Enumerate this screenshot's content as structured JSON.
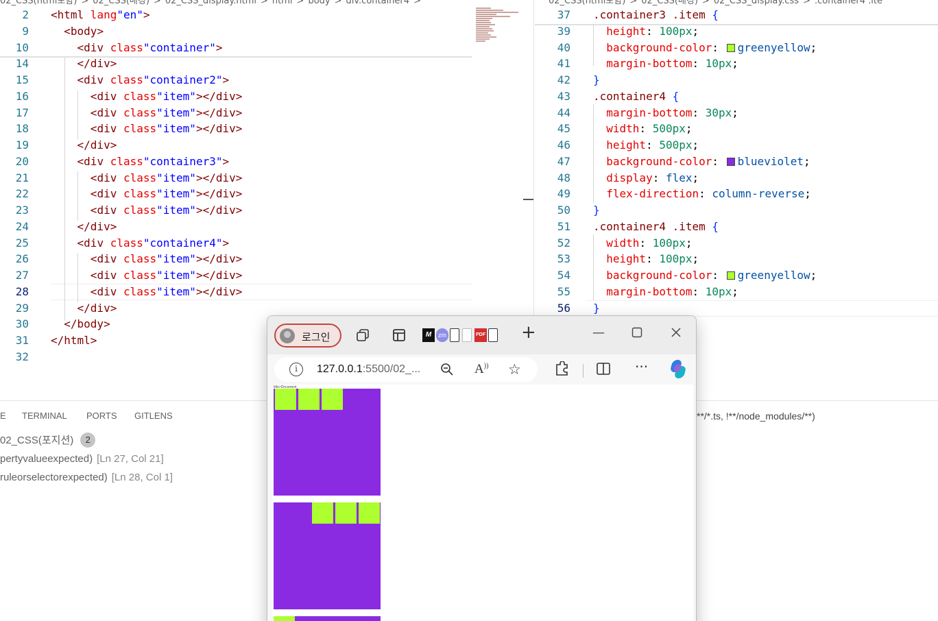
{
  "editor_left": {
    "breadcrumb": [
      "02_CSS(html포함)",
      ">",
      "02_CSS(배경)",
      ">",
      "02_CSS_display.html",
      ">",
      "html",
      ">",
      "body",
      ">",
      "div.container4",
      ">"
    ],
    "lines": [
      {
        "n": "2",
        "code": "<html lang=\"en\">"
      },
      {
        "n": "9",
        "code": "  <body>"
      },
      {
        "n": "10",
        "code": "    <div class=\"container\">"
      },
      {
        "n": "14",
        "code": "    </div>"
      },
      {
        "n": "15",
        "code": "    <div class=\"container2\">"
      },
      {
        "n": "16",
        "code": "      <div class=\"item\"></div>"
      },
      {
        "n": "17",
        "code": "      <div class=\"item\"></div>"
      },
      {
        "n": "18",
        "code": "      <div class=\"item\"></div>"
      },
      {
        "n": "19",
        "code": "    </div>"
      },
      {
        "n": "20",
        "code": "    <div class=\"container3\">"
      },
      {
        "n": "21",
        "code": "      <div class=\"item\"></div>"
      },
      {
        "n": "22",
        "code": "      <div class=\"item\"></div>"
      },
      {
        "n": "23",
        "code": "      <div class=\"item\"></div>"
      },
      {
        "n": "24",
        "code": "    </div>"
      },
      {
        "n": "25",
        "code": "    <div class=\"container4\">"
      },
      {
        "n": "26",
        "code": "      <div class=\"item\"></div>"
      },
      {
        "n": "27",
        "code": "      <div class=\"item\"></div>"
      },
      {
        "n": "28",
        "code": "      <div class=\"item\"></div>"
      },
      {
        "n": "29",
        "code": "    </div>"
      },
      {
        "n": "30",
        "code": "  </body>"
      },
      {
        "n": "31",
        "code": "</html>"
      },
      {
        "n": "32",
        "code": ""
      }
    ]
  },
  "editor_right": {
    "breadcrumb": [
      "02_CSS(html포함)",
      ">",
      "02_CSS(배경)",
      ">",
      "02_CSS_display.css",
      ">",
      ".container4 .ite"
    ],
    "lines": [
      {
        "n": "37",
        "code": ".container3 .item {"
      },
      {
        "n": "39",
        "code": "  height: 100px;"
      },
      {
        "n": "40",
        "code": "  background-color: greenyellow;"
      },
      {
        "n": "41",
        "code": "  margin-bottom: 10px;"
      },
      {
        "n": "42",
        "code": "}"
      },
      {
        "n": "43",
        "code": ".container4 {"
      },
      {
        "n": "44",
        "code": "  margin-bottom: 30px;"
      },
      {
        "n": "45",
        "code": "  width: 500px;"
      },
      {
        "n": "46",
        "code": "  height: 500px;"
      },
      {
        "n": "47",
        "code": "  background-color: blueviolet;"
      },
      {
        "n": "48",
        "code": "  display: flex;"
      },
      {
        "n": "49",
        "code": "  flex-direction: column-reverse;"
      },
      {
        "n": "50",
        "code": "}"
      },
      {
        "n": "51",
        "code": ".container4 .item {"
      },
      {
        "n": "52",
        "code": "  width: 100px;"
      },
      {
        "n": "53",
        "code": "  height: 100px;"
      },
      {
        "n": "54",
        "code": "  background-color: greenyellow;"
      },
      {
        "n": "55",
        "code": "  margin-bottom: 10px;"
      },
      {
        "n": "56",
        "code": "}"
      }
    ]
  },
  "panel": {
    "tabs": [
      "E",
      "TERMINAL",
      "PORTS",
      "GITLENS"
    ],
    "filter_text": "**/*.ts, !**/node_modules/**)",
    "problems_file": "02_CSS(포지션)",
    "problems_count": "2",
    "problems": [
      {
        "msg": "pertyvalueexpected)",
        "loc": "[Ln 27, Col 21]"
      },
      {
        "msg": "ruleorselectorexpected)",
        "loc": "[Ln 28, Col 1]"
      }
    ]
  },
  "browser": {
    "login_label": "로그인",
    "new_tab_label": "+",
    "url_host": "127.0.0.1",
    "url_rest": ":5500/02_...",
    "page_title_text": "title>Document",
    "colors": {
      "box": "#8a2be2",
      "item": "#adff2f"
    }
  }
}
